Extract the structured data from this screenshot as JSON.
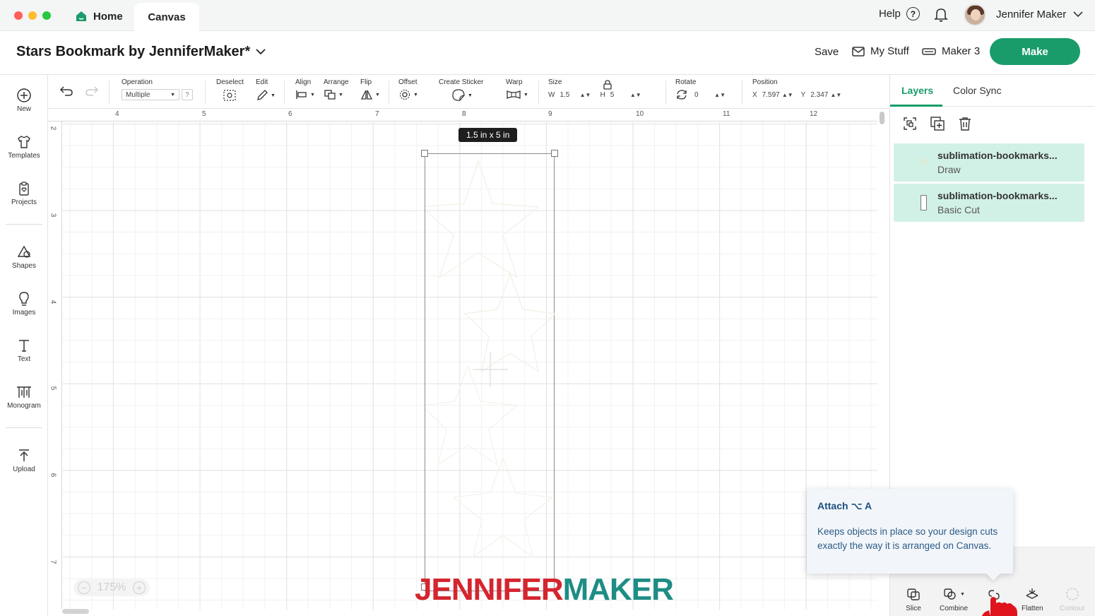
{
  "titlebar": {
    "home_tab": "Home",
    "canvas_tab": "Canvas",
    "help": "Help",
    "user_name": "Jennifer Maker"
  },
  "header": {
    "project_title": "Stars Bookmark by JenniferMaker*",
    "save": "Save",
    "my_stuff": "My Stuff",
    "machine": "Maker 3",
    "make": "Make",
    "accent_color": "#1a9c6a"
  },
  "sidebar": {
    "items": [
      {
        "label": "New",
        "icon": "plus-circle-icon"
      },
      {
        "label": "Templates",
        "icon": "shirt-icon"
      },
      {
        "label": "Projects",
        "icon": "clipboard-heart-icon"
      },
      {
        "label": "Shapes",
        "icon": "shapes-icon"
      },
      {
        "label": "Images",
        "icon": "lightbulb-icon"
      },
      {
        "label": "Text",
        "icon": "text-t-icon"
      },
      {
        "label": "Monogram",
        "icon": "monogram-icon"
      },
      {
        "label": "Upload",
        "icon": "upload-arrow-icon"
      }
    ]
  },
  "toolbar": {
    "operation_label": "Operation",
    "operation_value": "Multiple",
    "operation_help": "?",
    "deselect": "Deselect",
    "edit": "Edit",
    "align": "Align",
    "arrange": "Arrange",
    "flip": "Flip",
    "offset": "Offset",
    "create_sticker": "Create Sticker",
    "warp": "Warp",
    "size_label": "Size",
    "w_label": "W",
    "w_value": "1.5",
    "h_label": "H",
    "h_value": "5",
    "rotate_label": "Rotate",
    "rotate_value": "0",
    "position_label": "Position",
    "x_label": "X",
    "x_value": "7.597",
    "y_label": "Y",
    "y_value": "2.347"
  },
  "canvas": {
    "ruler_top": [
      "4",
      "5",
      "6",
      "7",
      "8",
      "9",
      "10",
      "11",
      "12"
    ],
    "ruler_left": [
      "2",
      "3",
      "4",
      "5",
      "6",
      "7"
    ],
    "size_tooltip": "1.5  in x 5  in",
    "zoom": "175%"
  },
  "watermark": {
    "part1": "JENNIFER",
    "part2": "MAKER",
    "color1": "#d5252f",
    "color2": "#1e8d85"
  },
  "layers_panel": {
    "tabs": [
      "Layers",
      "Color Sync"
    ],
    "layers": [
      {
        "name": "sublimation-bookmarks...",
        "operation": "Draw"
      },
      {
        "name": "sublimation-bookmarks...",
        "operation": "Basic Cut"
      }
    ],
    "bottom_tools": [
      {
        "label": "Slice",
        "icon": "slice-icon"
      },
      {
        "label": "Combine",
        "icon": "combine-icon"
      },
      {
        "label": "Flatten",
        "icon": "flatten-icon"
      },
      {
        "label": "Contour",
        "icon": "contour-icon"
      }
    ]
  },
  "tooltip": {
    "title": "Attach ⌥ A",
    "body": "Keeps objects in place so your design cuts exactly the way it is arranged on Canvas."
  }
}
